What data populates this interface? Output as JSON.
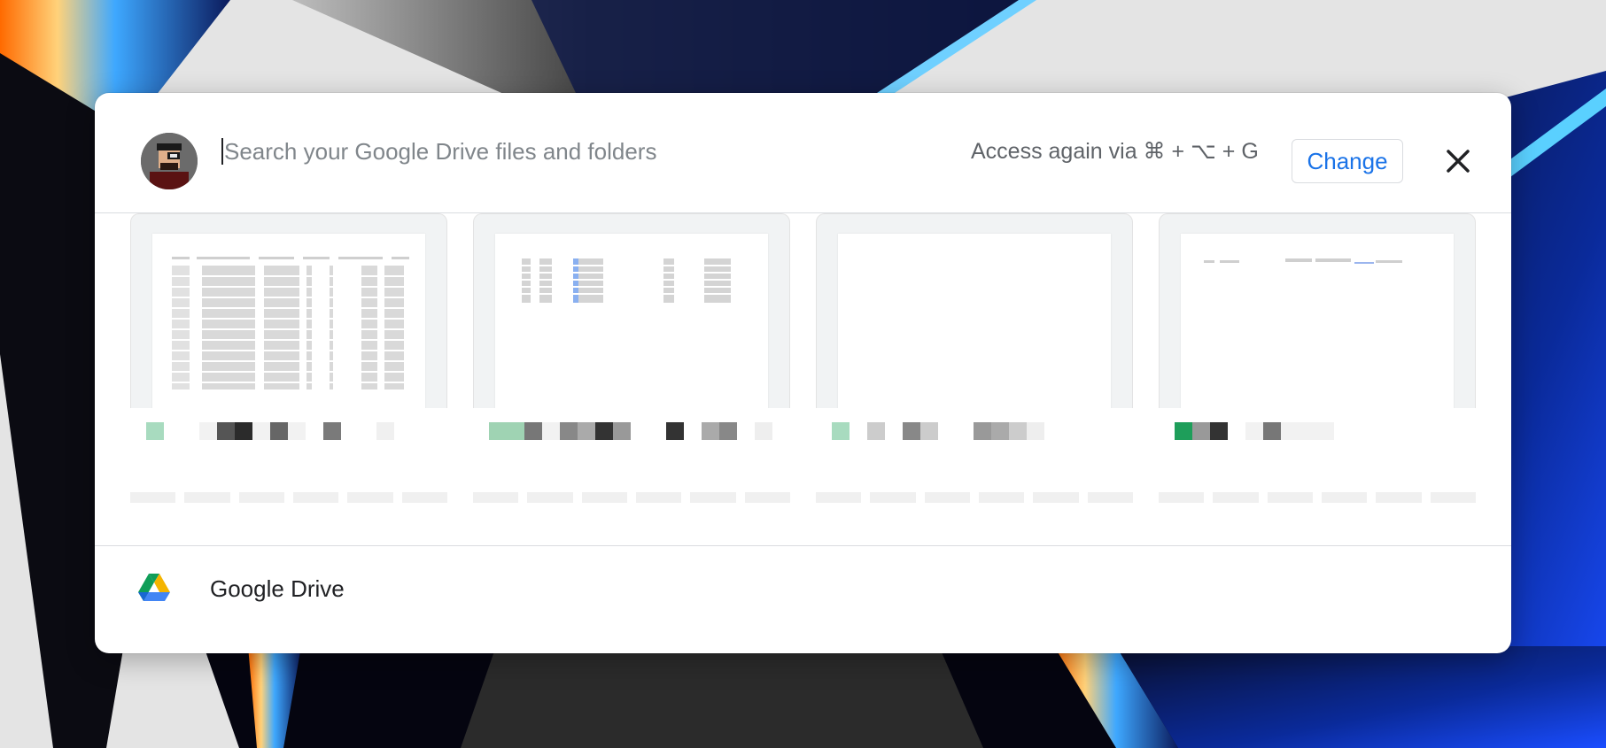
{
  "wallpaper": {
    "description_icon": "macos-wallpaper"
  },
  "header": {
    "avatar_icon": "user-avatar-icon",
    "search_placeholder": "Search your Google Drive files and folders",
    "access_hint": "Access again via ⌘ + ⌥ + G",
    "change_label": "Change",
    "close_icon": "close-icon"
  },
  "files": [
    {
      "thumb": "spreadsheet",
      "title_blocks": [
        "#a8dbbf",
        "#fff",
        "#fff",
        "#f2f2f2",
        "#555",
        "#2b2b2b",
        "#f2f2f2",
        "#666",
        "#f2f2f2",
        "#fff",
        "#7a7a7a",
        "#fff",
        "#fff",
        "#f0f0f0"
      ]
    },
    {
      "thumb": "spreadsheet-small",
      "title_blocks": [
        "#9fd3b3",
        "#9fd3b3",
        "#777",
        "#f2f2f2",
        "#888",
        "#aaa",
        "#333",
        "#999",
        "#fff",
        "#fff",
        "#333",
        "#fff",
        "#aaa",
        "#888",
        "#fff",
        "#eee"
      ]
    },
    {
      "thumb": "blank",
      "title_blocks": [
        "#a8dbbf",
        "#fff",
        "#ccc",
        "#fff",
        "#888",
        "#ccc",
        "#fff",
        "#fff",
        "#999",
        "#aaa",
        "#ccc",
        "#eee"
      ]
    },
    {
      "thumb": "doc",
      "title_blocks": [
        "#1e9e5a",
        "#999",
        "#333",
        "#fff",
        "#f2f2f2",
        "#777",
        "#f2f2f2",
        "#f2f2f2",
        "#f2f2f2"
      ]
    }
  ],
  "footer": {
    "drive_icon": "google-drive-icon",
    "label": "Google Drive"
  },
  "colors": {
    "accent": "#1a73e8",
    "drive_green": "#0f9d58",
    "drive_yellow": "#f4b400",
    "drive_blue": "#4285f4"
  }
}
